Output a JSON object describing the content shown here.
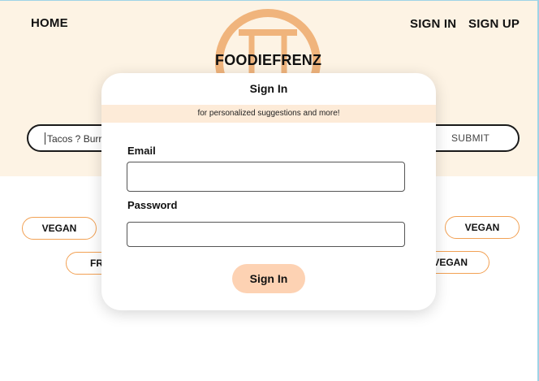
{
  "nav": {
    "home": "HOME",
    "sign_in": "SIGN IN",
    "sign_up": "SIGN UP"
  },
  "brand": {
    "name": "FOODIEFRENZ",
    "logo_icon": "plate-logo-icon"
  },
  "search": {
    "value": "Tacos ? Burr",
    "submit_label": "SUBMIT"
  },
  "tags": [
    {
      "label": "VEGAN"
    },
    {
      "label": "VEGAN"
    },
    {
      "label": "FR"
    },
    {
      "label": "VEGAN"
    }
  ],
  "modal": {
    "title": "Sign In",
    "subtitle": "for personalized suggestions and more!",
    "email_label": "Email",
    "email_value": "",
    "password_label": "Password",
    "password_value": "",
    "submit_label": "Sign In"
  },
  "colors": {
    "hero_bg": "#fdf3e4",
    "accent_orange": "#f2a154",
    "logo_orange": "#f0b47c",
    "banner_bg": "#fdebd8",
    "button_bg": "#fdd2b3"
  }
}
